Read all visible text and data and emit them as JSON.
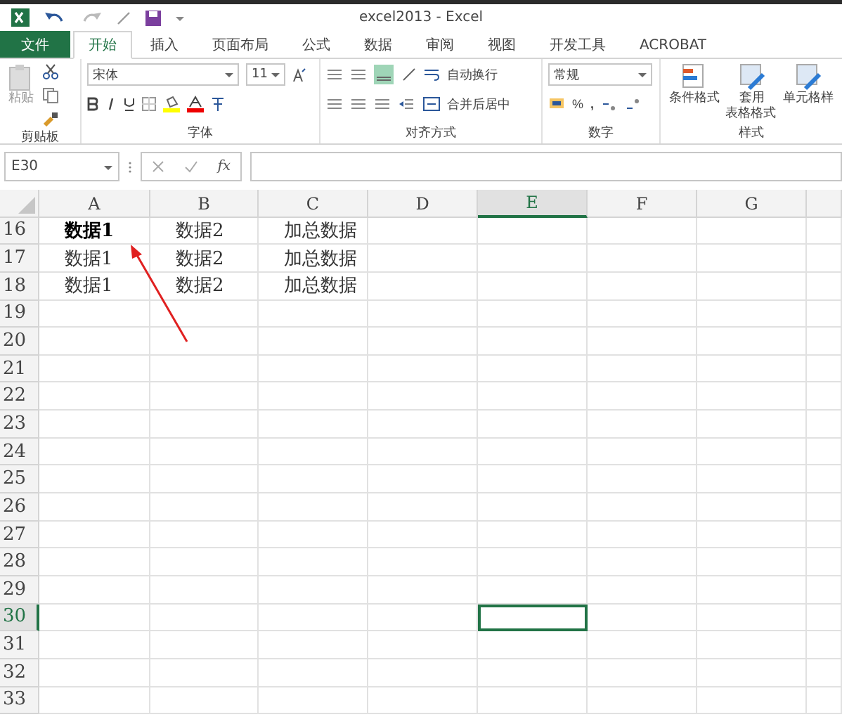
{
  "window": {
    "title": "excel2013 - Excel"
  },
  "tabs": [
    {
      "label": "文件",
      "kind": "file",
      "selected": false
    },
    {
      "label": "开始",
      "kind": "tab",
      "selected": true
    },
    {
      "label": "插入",
      "kind": "tab",
      "selected": false
    },
    {
      "label": "页面布局",
      "kind": "tab",
      "selected": false
    },
    {
      "label": "公式",
      "kind": "tab",
      "selected": false
    },
    {
      "label": "数据",
      "kind": "tab",
      "selected": false
    },
    {
      "label": "审阅",
      "kind": "tab",
      "selected": false
    },
    {
      "label": "视图",
      "kind": "tab",
      "selected": false
    },
    {
      "label": "开发工具",
      "kind": "tab",
      "selected": false
    },
    {
      "label": "ACROBAT",
      "kind": "tab",
      "selected": false
    }
  ],
  "ribbon": {
    "clipboard": {
      "paste": "粘贴",
      "label": "剪贴板"
    },
    "font": {
      "name": "宋体",
      "size": "11",
      "label": "字体"
    },
    "alignment": {
      "wrap": "自动换行",
      "merge": "合并后居中",
      "label": "对齐方式"
    },
    "number": {
      "format": "常规",
      "percent": "%",
      "comma": ",",
      "label": "数字"
    },
    "styles": {
      "buttons": [
        "条件格式",
        "套用表格格式",
        "单元格样"
      ],
      "label": "样式"
    }
  },
  "formula_bar": {
    "name_box": "E30",
    "fx": "fx"
  },
  "sheet": {
    "columns": [
      {
        "label": "A",
        "selected": false
      },
      {
        "label": "B",
        "selected": false
      },
      {
        "label": "C",
        "selected": false
      },
      {
        "label": "D",
        "selected": false
      },
      {
        "label": "E",
        "selected": true
      },
      {
        "label": "F",
        "selected": false
      },
      {
        "label": "G",
        "selected": false
      }
    ],
    "rows": [
      {
        "number": "16",
        "selected": false,
        "cells": [
          {
            "text": "数据1",
            "bold": true
          },
          {
            "text": "数据2",
            "bold": false
          },
          {
            "text": "加总数据",
            "bold": false
          }
        ]
      },
      {
        "number": "17",
        "selected": false,
        "cells": [
          {
            "text": "数据1",
            "bold": false
          },
          {
            "text": "数据2",
            "bold": false
          },
          {
            "text": "加总数据",
            "bold": false
          }
        ]
      },
      {
        "number": "18",
        "selected": false,
        "cells": [
          {
            "text": "数据1",
            "bold": false
          },
          {
            "text": "数据2",
            "bold": false
          },
          {
            "text": "加总数据",
            "bold": false
          }
        ]
      },
      {
        "number": "19",
        "selected": false,
        "cells": []
      },
      {
        "number": "20",
        "selected": false,
        "cells": []
      },
      {
        "number": "21",
        "selected": false,
        "cells": []
      },
      {
        "number": "22",
        "selected": false,
        "cells": []
      },
      {
        "number": "23",
        "selected": false,
        "cells": []
      },
      {
        "number": "24",
        "selected": false,
        "cells": []
      },
      {
        "number": "25",
        "selected": false,
        "cells": []
      },
      {
        "number": "26",
        "selected": false,
        "cells": []
      },
      {
        "number": "27",
        "selected": false,
        "cells": []
      },
      {
        "number": "28",
        "selected": false,
        "cells": []
      },
      {
        "number": "29",
        "selected": false,
        "cells": []
      },
      {
        "number": "30",
        "selected": true,
        "cells": []
      },
      {
        "number": "31",
        "selected": false,
        "cells": []
      },
      {
        "number": "32",
        "selected": false,
        "cells": []
      },
      {
        "number": "33",
        "selected": false,
        "cells": []
      }
    ]
  }
}
